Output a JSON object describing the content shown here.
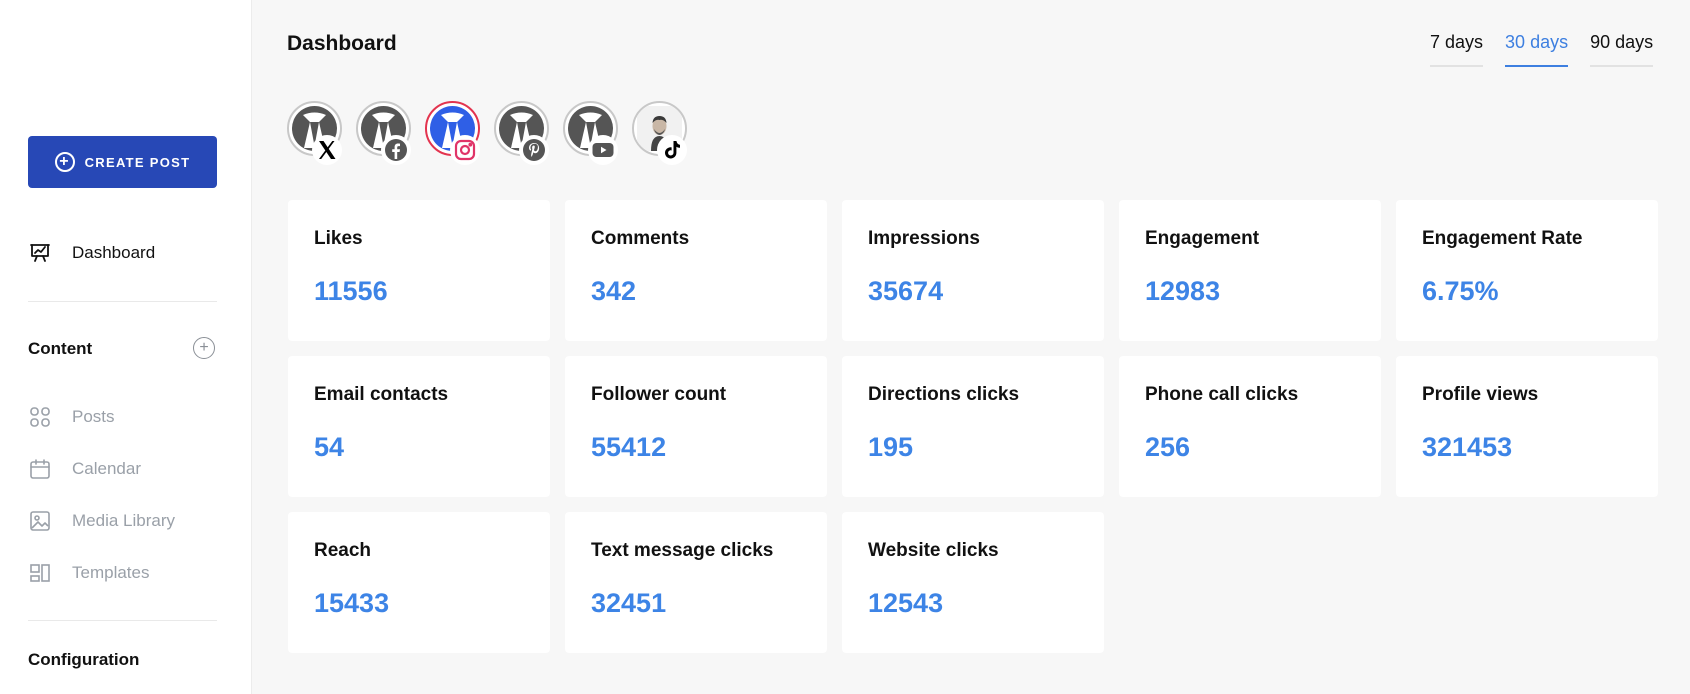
{
  "sidebar": {
    "create_post": "CREATE POST",
    "dashboard": "Dashboard",
    "content_title": "Content",
    "items": [
      {
        "label": "Posts",
        "icon": "grid-icon"
      },
      {
        "label": "Calendar",
        "icon": "calendar-icon"
      },
      {
        "label": "Media Library",
        "icon": "image-icon"
      },
      {
        "label": "Templates",
        "icon": "templates-icon"
      }
    ],
    "configuration_title": "Configuration"
  },
  "header": {
    "title": "Dashboard",
    "ranges": [
      {
        "label": "7 days",
        "active": false
      },
      {
        "label": "30 days",
        "active": true
      },
      {
        "label": "90 days",
        "active": false
      }
    ]
  },
  "accounts": [
    {
      "network": "x",
      "icon": "x-logo-icon",
      "selected": false
    },
    {
      "network": "facebook",
      "icon": "facebook-icon",
      "selected": false
    },
    {
      "network": "instagram",
      "icon": "instagram-icon",
      "selected": true
    },
    {
      "network": "pinterest",
      "icon": "pinterest-icon",
      "selected": false
    },
    {
      "network": "youtube",
      "icon": "youtube-icon",
      "selected": false
    },
    {
      "network": "tiktok",
      "icon": "tiktok-icon",
      "selected": false
    }
  ],
  "metrics": [
    {
      "label": "Likes",
      "value": "11556"
    },
    {
      "label": "Comments",
      "value": "342"
    },
    {
      "label": "Impressions",
      "value": "35674"
    },
    {
      "label": "Engagement",
      "value": "12983"
    },
    {
      "label": "Engagement Rate",
      "value": "6.75%"
    },
    {
      "label": "Email contacts",
      "value": "54"
    },
    {
      "label": "Follower count",
      "value": "55412"
    },
    {
      "label": "Directions clicks",
      "value": "195"
    },
    {
      "label": "Phone call clicks",
      "value": "256"
    },
    {
      "label": "Profile views",
      "value": "321453"
    },
    {
      "label": "Reach",
      "value": "15433"
    },
    {
      "label": "Text message clicks",
      "value": "32451"
    },
    {
      "label": "Website clicks",
      "value": "12543"
    }
  ],
  "colors": {
    "accent": "#3d84e6",
    "create_button": "#2748b6",
    "selected_ring": "#e3344f"
  }
}
